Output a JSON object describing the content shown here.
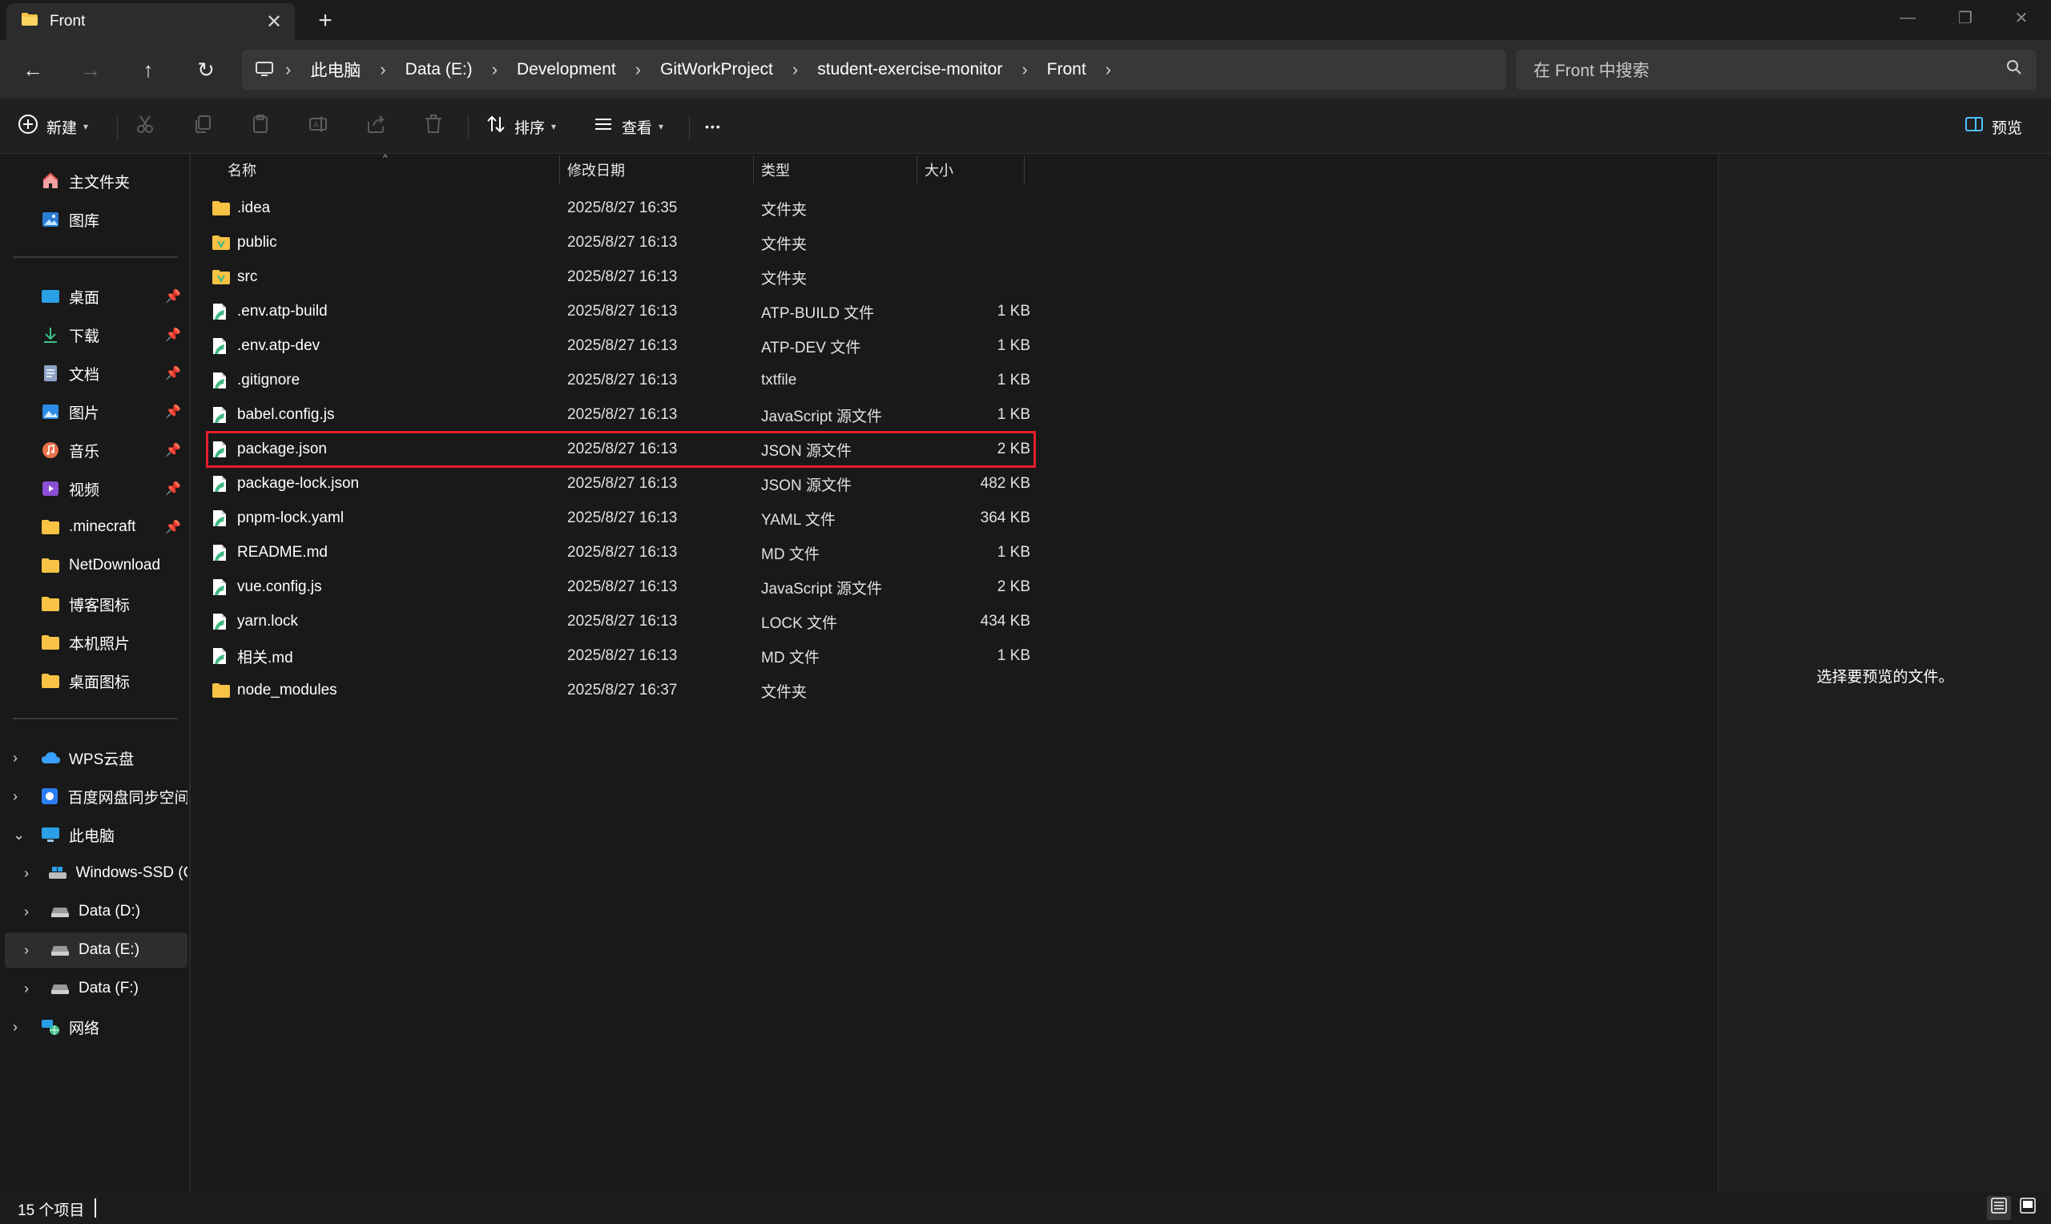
{
  "window": {
    "tab_title": "Front",
    "close_tab_glyph": "✕",
    "new_tab_glyph": "+",
    "minimize_glyph": "—",
    "restore_glyph": "❐",
    "close_glyph": "✕"
  },
  "nav": {
    "back_glyph": "←",
    "forward_glyph": "→",
    "up_glyph": "↑",
    "refresh_glyph": "↻",
    "breadcrumbs": [
      "此电脑",
      "Data (E:)",
      "Development",
      "GitWorkProject",
      "student-exercise-monitor",
      "Front"
    ],
    "separator": "›",
    "search_placeholder": "在 Front 中搜索"
  },
  "commandbar": {
    "new_label": "新建",
    "sort_label": "排序",
    "view_label": "查看",
    "more_glyph": "•••",
    "preview_label": "预览",
    "caret": "▾"
  },
  "sidebar": {
    "quick": [
      {
        "label": "主文件夹",
        "icon": "home-icon"
      },
      {
        "label": "图库",
        "icon": "gallery-icon"
      }
    ],
    "pinned": [
      {
        "label": "桌面",
        "icon": "desktop-icon",
        "pinned": true
      },
      {
        "label": "下载",
        "icon": "download-icon",
        "pinned": true
      },
      {
        "label": "文档",
        "icon": "document-icon",
        "pinned": true
      },
      {
        "label": "图片",
        "icon": "pictures-icon",
        "pinned": true
      },
      {
        "label": "音乐",
        "icon": "music-icon",
        "pinned": true
      },
      {
        "label": "视频",
        "icon": "video-icon",
        "pinned": true
      },
      {
        "label": ".minecraft",
        "icon": "folder-icon",
        "pinned": true
      },
      {
        "label": "NetDownload",
        "icon": "folder-icon",
        "pinned": false
      },
      {
        "label": "博客图标",
        "icon": "folder-icon",
        "pinned": false
      },
      {
        "label": "本机照片",
        "icon": "folder-icon",
        "pinned": false
      },
      {
        "label": "桌面图标",
        "icon": "folder-icon",
        "pinned": false
      }
    ],
    "pin_glyph": "📌",
    "tree": [
      {
        "label": "WPS云盘",
        "icon": "cloud-icon",
        "level": 0,
        "expanded": false
      },
      {
        "label": "百度网盘同步空间",
        "icon": "baidu-icon",
        "level": 0,
        "expanded": false
      },
      {
        "label": "此电脑",
        "icon": "computer-icon",
        "level": 0,
        "expanded": true
      },
      {
        "label": "Windows-SSD (C",
        "icon": "windows-drive-icon",
        "level": 1,
        "expanded": false
      },
      {
        "label": "Data (D:)",
        "icon": "drive-icon",
        "level": 1,
        "expanded": false
      },
      {
        "label": "Data (E:)",
        "icon": "drive-icon",
        "level": 1,
        "expanded": false,
        "selected": true
      },
      {
        "label": "Data (F:)",
        "icon": "drive-icon",
        "level": 1,
        "expanded": false
      },
      {
        "label": "网络",
        "icon": "network-icon",
        "level": 0,
        "expanded": false
      }
    ]
  },
  "columns": {
    "name": "名称",
    "modified": "修改日期",
    "type": "类型",
    "size": "大小"
  },
  "files": [
    {
      "name": ".idea",
      "date": "2025/8/27 16:35",
      "type": "文件夹",
      "size": "",
      "kind": "folder"
    },
    {
      "name": "public",
      "date": "2025/8/27 16:13",
      "type": "文件夹",
      "size": "",
      "kind": "folder-vue"
    },
    {
      "name": "src",
      "date": "2025/8/27 16:13",
      "type": "文件夹",
      "size": "",
      "kind": "folder-vue"
    },
    {
      "name": ".env.atp-build",
      "date": "2025/8/27 16:13",
      "type": "ATP-BUILD 文件",
      "size": "1 KB",
      "kind": "file"
    },
    {
      "name": ".env.atp-dev",
      "date": "2025/8/27 16:13",
      "type": "ATP-DEV 文件",
      "size": "1 KB",
      "kind": "file"
    },
    {
      "name": ".gitignore",
      "date": "2025/8/27 16:13",
      "type": "txtfile",
      "size": "1 KB",
      "kind": "file"
    },
    {
      "name": "babel.config.js",
      "date": "2025/8/27 16:13",
      "type": "JavaScript 源文件",
      "size": "1 KB",
      "kind": "file"
    },
    {
      "name": "package.json",
      "date": "2025/8/27 16:13",
      "type": "JSON 源文件",
      "size": "2 KB",
      "kind": "file",
      "highlighted": true
    },
    {
      "name": "package-lock.json",
      "date": "2025/8/27 16:13",
      "type": "JSON 源文件",
      "size": "482 KB",
      "kind": "file"
    },
    {
      "name": "pnpm-lock.yaml",
      "date": "2025/8/27 16:13",
      "type": "YAML 文件",
      "size": "364 KB",
      "kind": "file"
    },
    {
      "name": "README.md",
      "date": "2025/8/27 16:13",
      "type": "MD 文件",
      "size": "1 KB",
      "kind": "file"
    },
    {
      "name": "vue.config.js",
      "date": "2025/8/27 16:13",
      "type": "JavaScript 源文件",
      "size": "2 KB",
      "kind": "file"
    },
    {
      "name": "yarn.lock",
      "date": "2025/8/27 16:13",
      "type": "LOCK 文件",
      "size": "434 KB",
      "kind": "file"
    },
    {
      "name": "相关.md",
      "date": "2025/8/27 16:13",
      "type": "MD 文件",
      "size": "1 KB",
      "kind": "file"
    },
    {
      "name": "node_modules",
      "date": "2025/8/27 16:37",
      "type": "文件夹",
      "size": "",
      "kind": "folder"
    }
  ],
  "preview": {
    "message": "选择要预览的文件。"
  },
  "status": {
    "item_count": "15 个项目"
  },
  "colors": {
    "folder": "#f8c244",
    "vue_green": "#41b883",
    "highlight_border": "#e81e2a",
    "accent_blue": "#4cc2ff"
  }
}
